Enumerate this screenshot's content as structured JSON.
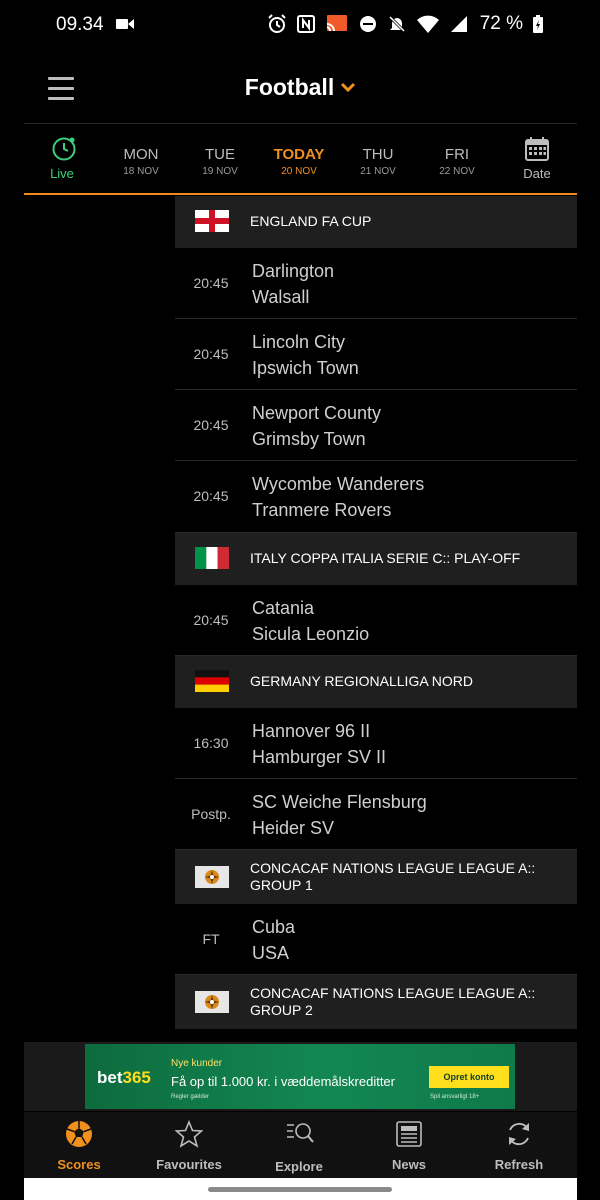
{
  "status_bar": {
    "time": "09.34",
    "battery": "72 %"
  },
  "header": {
    "title": "Football"
  },
  "date_bar": {
    "live_label": "Live",
    "days": [
      {
        "dow": "MON",
        "date": "18 NOV",
        "active": false
      },
      {
        "dow": "TUE",
        "date": "19 NOV",
        "active": false
      },
      {
        "dow": "TODAY",
        "date": "20 NOV",
        "active": true
      },
      {
        "dow": "THU",
        "date": "21 NOV",
        "active": false
      },
      {
        "dow": "FRI",
        "date": "22 NOV",
        "active": false
      }
    ],
    "date_label": "Date"
  },
  "leagues": [
    {
      "name": "ENGLAND FA CUP",
      "flag": "england-flag-icon",
      "matches": [
        {
          "time": "20:45",
          "home": "Darlington",
          "away": "Walsall"
        },
        {
          "time": "20:45",
          "home": "Lincoln City",
          "away": "Ipswich Town"
        },
        {
          "time": "20:45",
          "home": "Newport County",
          "away": "Grimsby Town"
        },
        {
          "time": "20:45",
          "home": "Wycombe Wanderers",
          "away": "Tranmere Rovers"
        }
      ]
    },
    {
      "name": "ITALY COPPA ITALIA SERIE C:: PLAY-OFF",
      "flag": "italy-flag-icon",
      "matches": [
        {
          "time": "20:45",
          "home": "Catania",
          "away": "Sicula Leonzio"
        }
      ]
    },
    {
      "name": "GERMANY REGIONALLIGA NORD",
      "flag": "germany-flag-icon",
      "matches": [
        {
          "time": "16:30",
          "home": "Hannover 96 II",
          "away": "Hamburger SV II"
        },
        {
          "time": "Postp.",
          "home": "SC Weiche Flensburg",
          "away": "Heider SV"
        }
      ]
    },
    {
      "name": "CONCACAF NATIONS LEAGUE LEAGUE A:: GROUP 1",
      "flag": "concacaf-logo-icon",
      "matches": [
        {
          "time": "FT",
          "home": "Cuba",
          "away": "USA"
        }
      ]
    },
    {
      "name": "CONCACAF NATIONS LEAGUE LEAGUE A:: GROUP 2",
      "flag": "concacaf-logo-icon",
      "matches": []
    }
  ],
  "ad": {
    "brand_a": "bet",
    "brand_b": "365",
    "kicker": "Nye kunder",
    "headline": "Få op til 1.000 kr. i væddemålskreditter",
    "rules": "Regler gælder",
    "cta": "Opret konto",
    "responsible": "Spil ansvarligt 18+"
  },
  "bottom_nav": [
    {
      "label": "Scores",
      "icon": "soccer-ball-icon",
      "active": true
    },
    {
      "label": "Favourites",
      "icon": "star-icon",
      "active": false
    },
    {
      "label": "Explore",
      "icon": "explore-search-icon",
      "active": false
    },
    {
      "label": "News",
      "icon": "newspaper-icon",
      "active": false
    },
    {
      "label": "Refresh",
      "icon": "refresh-icon",
      "active": false
    }
  ],
  "colors": {
    "accent": "#f0901f",
    "live_green": "#3cd07a",
    "league_header_bg": "#1f1f1f",
    "background": "#000000"
  }
}
